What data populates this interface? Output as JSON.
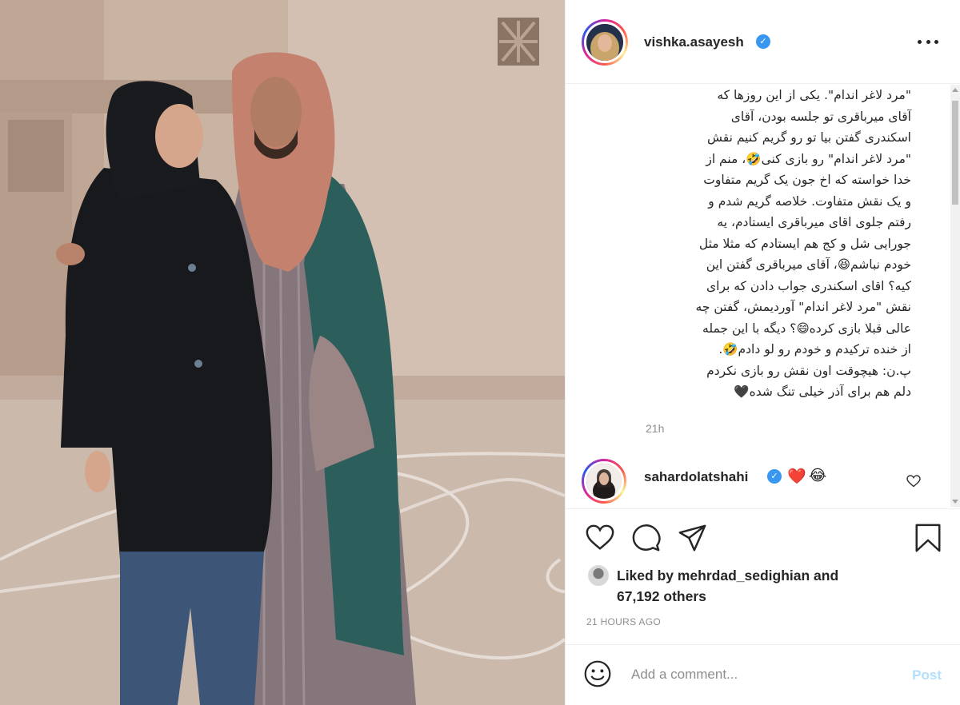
{
  "post": {
    "username": "vishka.asayesh",
    "verified": true,
    "caption_lines": [
      "\"مرد لاغر اندام\". یکی از این روزها که",
      "آقای میرباقری تو جلسه بودن، آقای",
      "اسکندری گفتن بیا تو رو گریم کنیم نقش",
      "\"مرد لاغر اندام\" رو بازی کنی🤣، منم از",
      "خدا خواسته که اخ جون یک گریم متفاوت",
      "و یک نقش متفاوت. خلاصه گریم شدم و",
      "رفتم جلوی اقای میرباقری ایستادم، یه",
      "جورایی شل و کج هم ایستادم که مثلا مثل",
      "خودم نباشم😆، آقای میرباقری گفتن این",
      "کیه؟ اقای اسکندری جواب دادن که برای",
      "نقش \"مرد لاغر اندام\" آوردیمش، گفتن چه",
      "عالی قبلا بازی کرده😄؟ دیگه با این جمله",
      "از خنده ترکیدم و خودم رو لو دادم🤣.",
      "پ.ن: هیچوقت اون نقش رو بازی نکردم",
      "دلم هم برای آذر خیلی تنگ شده🖤"
    ],
    "caption_age": "21h"
  },
  "comment": {
    "username": "sahardolatshahi",
    "verified": true,
    "emojis": [
      "❤️",
      "😂"
    ]
  },
  "actions": {
    "like_icon": "heart-icon",
    "comment_icon": "comment-icon",
    "share_icon": "share-icon",
    "save_icon": "bookmark-icon"
  },
  "likes": {
    "prefix": "Liked by ",
    "user": "mehrdad_sedighian",
    "middle": " and",
    "count": "67,192 others"
  },
  "timestamp": "21 HOURS AGO",
  "add_comment": {
    "placeholder": "Add a comment...",
    "post_label": "Post"
  },
  "colors": {
    "accent_blue": "#3897f0",
    "post_disabled": "#b2dffc",
    "heart_red": "#ed4956",
    "muted_text": "#8e8e8e"
  }
}
